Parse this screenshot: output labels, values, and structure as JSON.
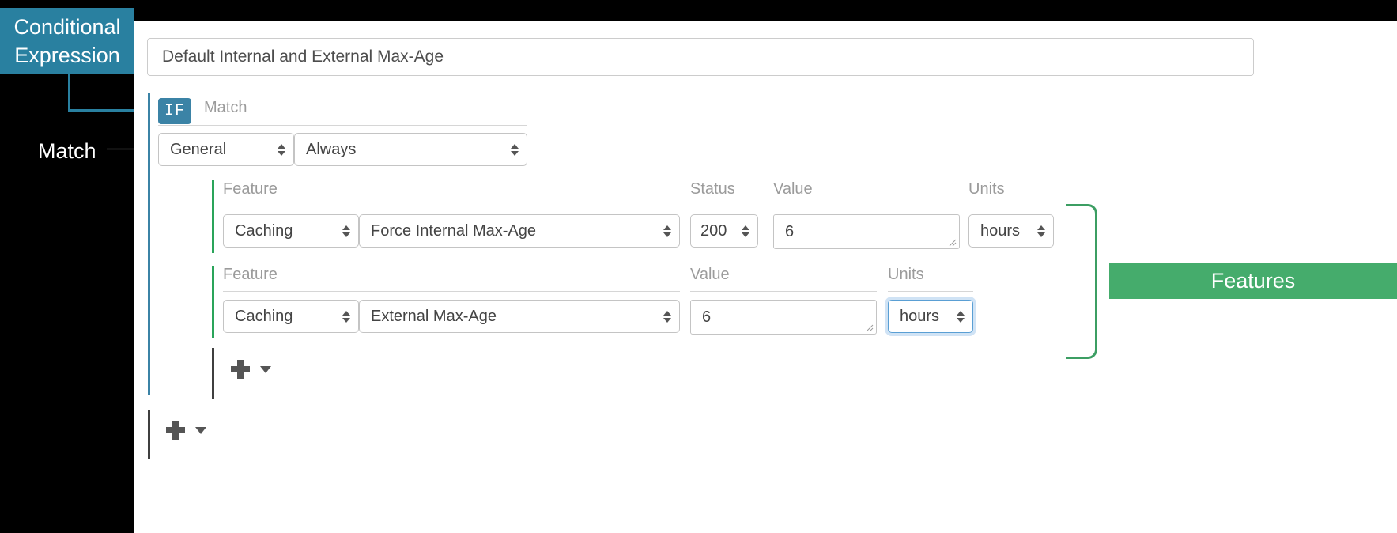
{
  "annotations": {
    "conditional_expression": "Conditional Expression",
    "match": "Match",
    "features": "Features"
  },
  "editor": {
    "rule_title": "Default Internal and External Max-Age",
    "if_badge": "IF",
    "match_legend": "Match",
    "match_row": {
      "category": "General",
      "condition": "Always"
    },
    "labels": {
      "feature": "Feature",
      "status": "Status",
      "value": "Value",
      "units": "Units"
    },
    "feature_rows": [
      {
        "feature_group": "Caching",
        "feature_name": "Force Internal Max-Age",
        "status": "200",
        "value": "6",
        "units": "hours"
      },
      {
        "feature_group": "Caching",
        "feature_name": "External Max-Age",
        "value": "6",
        "units": "hours"
      }
    ],
    "add_feature_button": "+",
    "add_feature_caret": "▾",
    "add_rule_button": "+",
    "add_rule_caret": "▾"
  },
  "colors": {
    "accent_blue": "#3b83a6",
    "accent_green": "#45ac6c",
    "rail_green": "#2aa45a",
    "focus_blue": "#5a9fd4"
  }
}
